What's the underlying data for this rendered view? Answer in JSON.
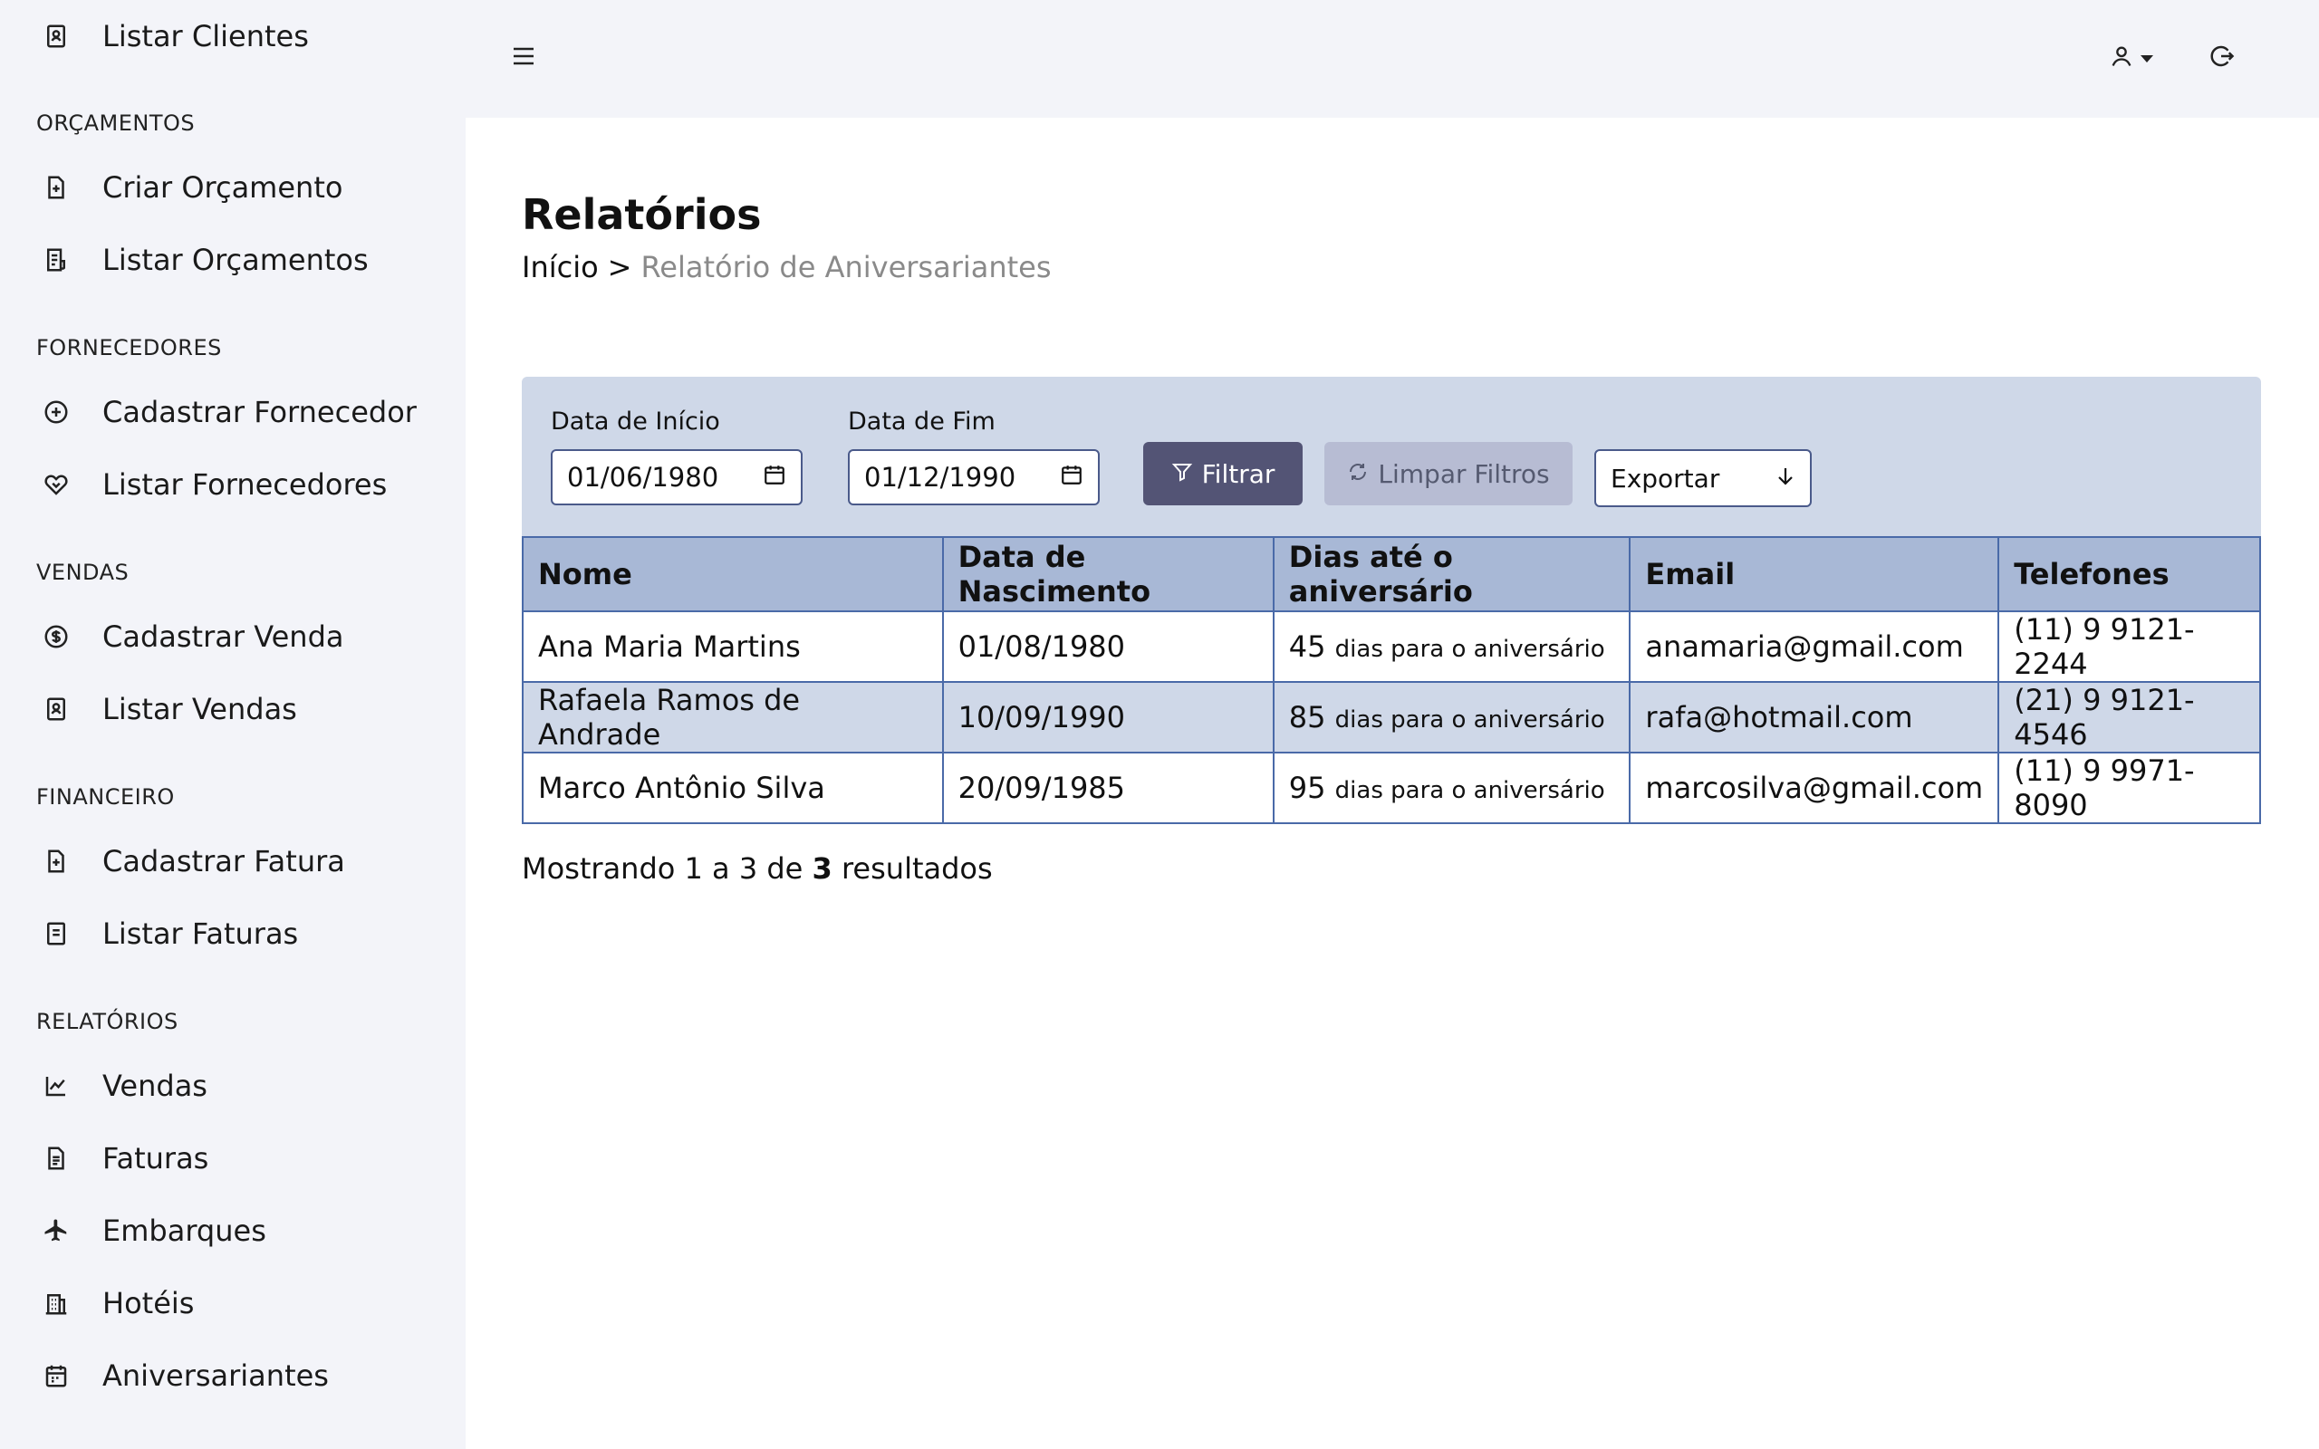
{
  "sidebar": {
    "sections": [
      {
        "title": "",
        "items": [
          {
            "label": "Listar Clientes",
            "icon": "contact-book-icon"
          }
        ]
      },
      {
        "title": "ORÇAMENTOS",
        "items": [
          {
            "label": "Criar Orçamento",
            "icon": "file-plus-icon"
          },
          {
            "label": "Listar Orçamentos",
            "icon": "file-list-icon"
          }
        ]
      },
      {
        "title": "FORNECEDORES",
        "items": [
          {
            "label": "Cadastrar Fornecedor",
            "icon": "plus-circle-icon"
          },
          {
            "label": "Listar Fornecedores",
            "icon": "handshake-heart-icon"
          }
        ]
      },
      {
        "title": "VENDAS",
        "items": [
          {
            "label": "Cadastrar Venda",
            "icon": "money-circle-icon"
          },
          {
            "label": "Listar Vendas",
            "icon": "contact-book-icon"
          }
        ]
      },
      {
        "title": "FINANCEIRO",
        "items": [
          {
            "label": "Cadastrar Fatura",
            "icon": "file-plus-icon"
          },
          {
            "label": "Listar Faturas",
            "icon": "document-icon"
          }
        ]
      },
      {
        "title": "RELATÓRIOS",
        "items": [
          {
            "label": "Vendas",
            "icon": "line-chart-icon"
          },
          {
            "label": "Faturas",
            "icon": "file-text-icon"
          },
          {
            "label": "Embarques",
            "icon": "airplane-icon"
          },
          {
            "label": "Hotéis",
            "icon": "building-icon"
          },
          {
            "label": "Aniversariantes",
            "icon": "calendar-icon"
          }
        ]
      }
    ]
  },
  "page": {
    "title": "Relatórios",
    "breadcrumb": {
      "home": "Início",
      "separator": ">",
      "current": "Relatório de Aniversariantes"
    }
  },
  "filters": {
    "start_label": "Data de Início",
    "start_value": "01/06/1980",
    "end_label": "Data de Fim",
    "end_value": "01/12/1990",
    "filter_button": "Filtrar",
    "clear_button": "Limpar Filtros",
    "export_select": "Exportar"
  },
  "table": {
    "headers": [
      "Nome",
      "Data de Nascimento",
      "Dias até o aniversário",
      "Email",
      "Telefones"
    ],
    "rows": [
      {
        "name": "Ana Maria Martins",
        "birth": "01/08/1980",
        "days": "45",
        "days_text": "dias para o aniversário",
        "email": "anamaria@gmail.com",
        "phone": "(11) 9 9121-2244"
      },
      {
        "name": "Rafaela Ramos de Andrade",
        "birth": "10/09/1990",
        "days": "85",
        "days_text": "dias para o aniversário",
        "email": "rafa@hotmail.com",
        "phone": "(21) 9 9121-4546"
      },
      {
        "name": "Marco Antônio Silva",
        "birth": "20/09/1985",
        "days": "95",
        "days_text": "dias para o aniversário",
        "email": "marcosilva@gmail.com",
        "phone": "(11) 9 9971-8090"
      }
    ]
  },
  "results": {
    "prefix": "Mostrando 1 a 3 de",
    "total": "3",
    "suffix": "resultados"
  },
  "colors": {
    "sidebar_bg": "#f3f4f9",
    "filter_bg": "#cfd8e8",
    "header_bg": "#a8b8d6",
    "primary_button": "#535475",
    "secondary_button": "#b7bcd3",
    "border": "#4a6aa8"
  }
}
